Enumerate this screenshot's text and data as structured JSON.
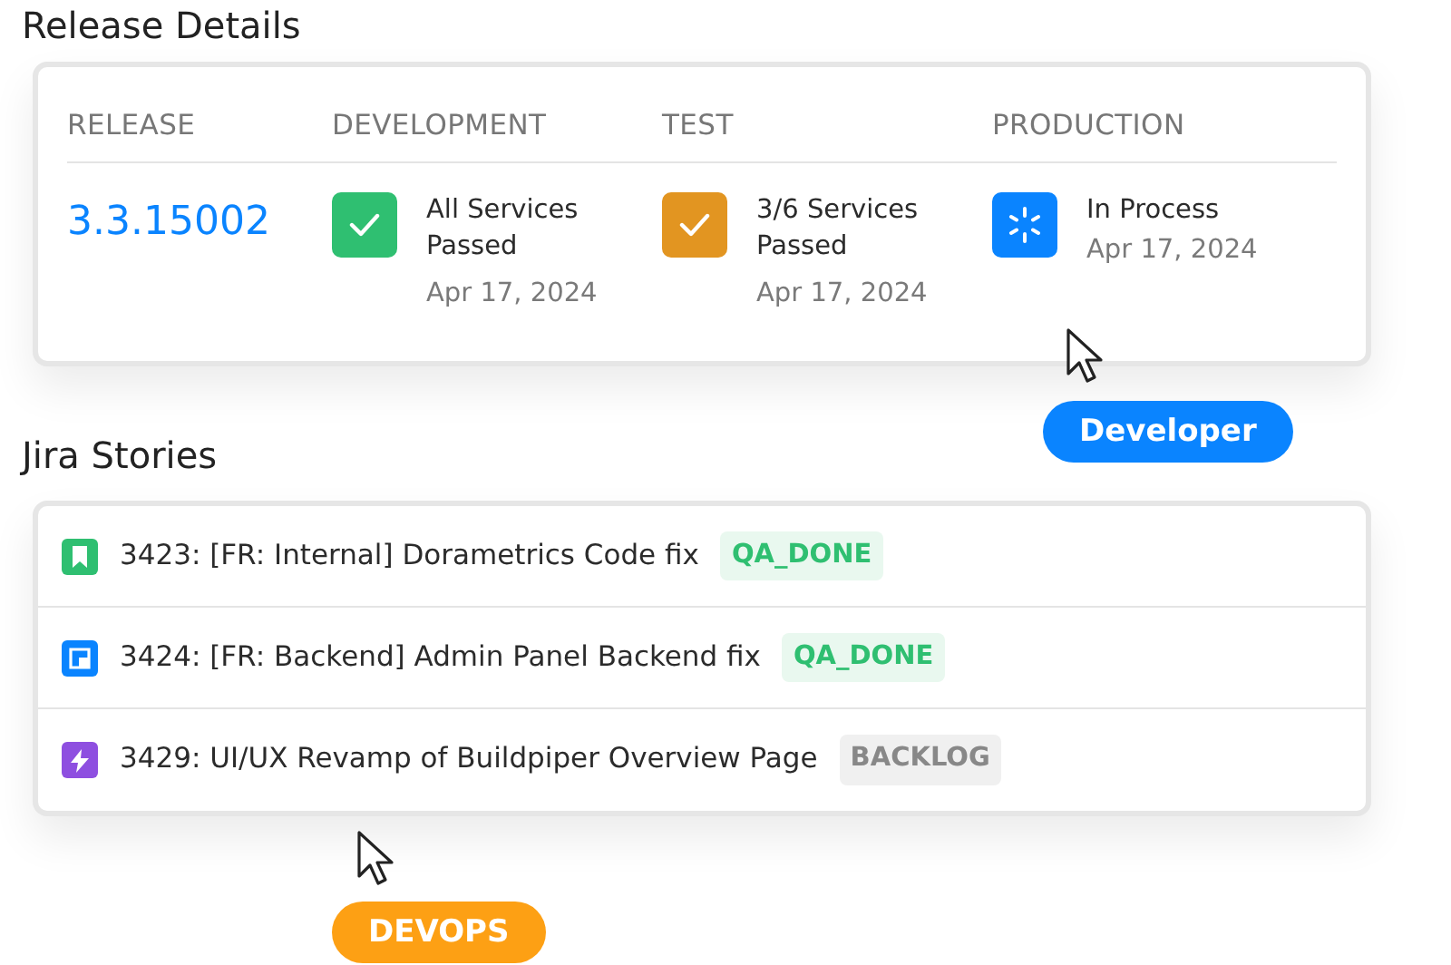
{
  "release_section": {
    "title": "Release Details",
    "columns": [
      "RELEASE",
      "DEVELOPMENT",
      "TEST",
      "PRODUCTION"
    ],
    "release": "3.3.15002",
    "stages": [
      {
        "kind": "passed",
        "color": "#2fbf71",
        "status": "All Services Passed",
        "date": "Apr 17, 2024"
      },
      {
        "kind": "passed",
        "color": "#e29521",
        "status": "3/6 Services Passed",
        "date": "Apr 17, 2024"
      },
      {
        "kind": "in_process",
        "color": "#0a84ff",
        "status": "In Process",
        "date": "Apr 17, 2024"
      }
    ]
  },
  "stories_section": {
    "title": "Jira Stories",
    "stories": [
      {
        "kind": "story",
        "color": "#2fbf71",
        "title": "3423: [FR: Internal] Dorametrics Code fix",
        "tag": {
          "kind": "done",
          "label": "QA_DONE"
        }
      },
      {
        "kind": "task",
        "color": "#0a84ff",
        "title": "3424: [FR: Backend] Admin Panel Backend fix",
        "tag": {
          "kind": "done",
          "label": "QA_DONE"
        }
      },
      {
        "kind": "epic",
        "color": "#8e4fe0",
        "title": "3429: UI/UX Revamp of Buildpiper Overview Page",
        "tag": {
          "kind": "backlog",
          "label": "BACKLOG"
        }
      }
    ]
  },
  "pointers": [
    {
      "label": "Developer",
      "color": "#0a84ff"
    },
    {
      "label": "DEVOPS",
      "color": "#fda014"
    }
  ]
}
